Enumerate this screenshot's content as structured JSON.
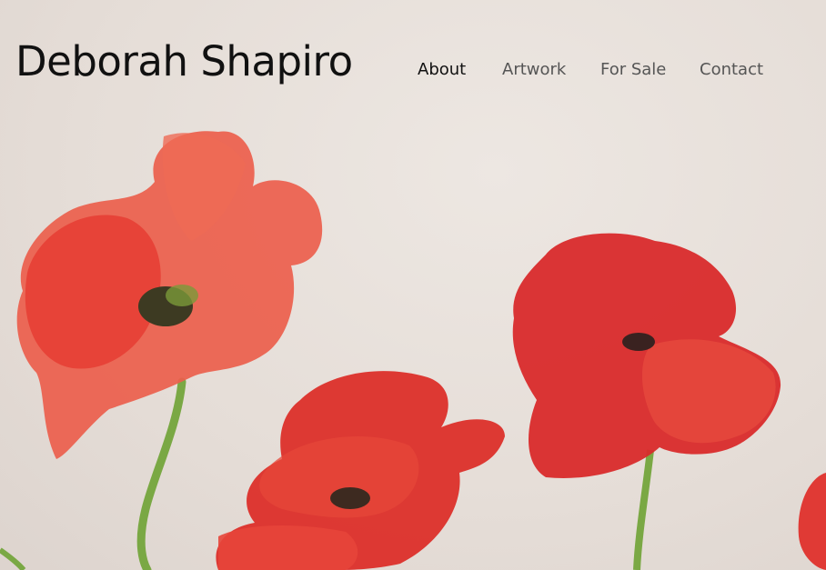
{
  "site": {
    "title": "Deborah Shapiro"
  },
  "nav": {
    "items": [
      {
        "label": "About",
        "active": true
      },
      {
        "label": "Artwork",
        "active": false
      },
      {
        "label": "For Sale",
        "active": false
      },
      {
        "label": "Contact",
        "active": false
      }
    ]
  },
  "colors": {
    "title_text": "#111111",
    "nav_active": "#111111",
    "nav_inactive": "#555555",
    "background": "#e7e0db",
    "poppy_red": "#e0302c",
    "poppy_coral": "#ec5d4d",
    "stem_green": "#79a841"
  }
}
